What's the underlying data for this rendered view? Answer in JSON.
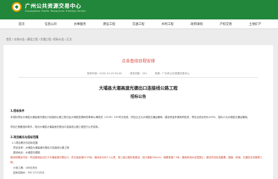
{
  "header": {
    "site_name": "广州公共资源交易中心",
    "site_sub": "Guangzhou Public Resources Trading Center"
  },
  "nav": {
    "items": [
      "首页",
      "信息公开",
      "办事服务",
      "建设工程",
      "交通工程",
      "水利工程",
      "政府采购",
      "产权交易",
      "土地矿产",
      "公共服务"
    ]
  },
  "breadcrumb": "首页 / 交易公告 / 建设工程 / 交通工程 / 招标公告 / 正文",
  "page_link": "点击查阅日程安排",
  "meta": {
    "date": "发布时间：2020-10-29 00:00",
    "views": "浏览次数：201",
    "source": "来源：广州市公共资源交易中心"
  },
  "doc": {
    "title": "大埔县大潮高速光德出口连接线公路工程",
    "subtitle": "招标公告",
    "s1_heading": "1.招标条件",
    "s1_para": "本招标项目大埔县大潮高速光德出口连接线公路工程已由大埔县发展和改革局以埔发改（2019）235号文批准，项目业主为大埔县交通运输局，建设资金来源政府投资，项目出资比例为100%，招标人为大埔县交通运输局。",
    "s1_para2": "项目已具备招标条件，现对大埔县大潮高速光德出口连接线公路工程进行公开招标。",
    "s2_heading": "2.项目概况与招标范围",
    "s2_sub": "2.1项目概况与招标范围",
    "s2_items": [
      "项目名称：大埔县大潮高速光德出口连接线公路工程",
      "建设地点：大埔县光德镇"
    ],
    "s2_para_red": "建设规模及内容：项目路线起点位于大潮高速光德出口，终点接省道S223线，路线全长约3.1公里，按三级公路标准建设，设计速度30km/h，路基宽度7.5米，路面采用水泥混凝土，建设内容包括路基、路面、桥涵、交通安全设施等工程。",
    "s2_items2": [
      "计划工期：180日历天",
      "招标控制价：397.2713万元"
    ]
  }
}
